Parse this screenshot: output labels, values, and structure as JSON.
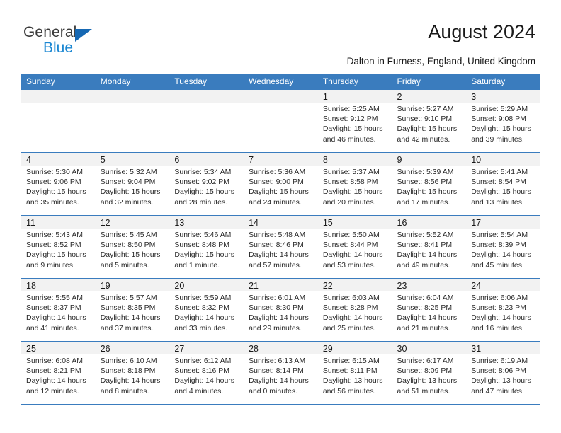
{
  "brand": {
    "name_top": "General",
    "name_bottom": "Blue",
    "accent_color": "#1b87d2",
    "triangle_color": "#1668b3"
  },
  "header": {
    "title": "August 2024",
    "subtitle": "Dalton in Furness, England, United Kingdom"
  },
  "theme": {
    "header_row_bg": "#3a7cbe",
    "cell_shade_bg": "#f2f2f2",
    "grid_line": "#3a7cbe"
  },
  "weekdays": [
    "Sunday",
    "Monday",
    "Tuesday",
    "Wednesday",
    "Thursday",
    "Friday",
    "Saturday"
  ],
  "labels": {
    "sunrise_prefix": "Sunrise:",
    "sunset_prefix": "Sunset:",
    "daylight_prefix": "Daylight:"
  },
  "weeks": [
    [
      {
        "empty": true
      },
      {
        "empty": true
      },
      {
        "empty": true
      },
      {
        "empty": true
      },
      {
        "day": "1",
        "sunrise": "Sunrise: 5:25 AM",
        "sunset": "Sunset: 9:12 PM",
        "daylight1": "Daylight: 15 hours",
        "daylight2": "and 46 minutes."
      },
      {
        "day": "2",
        "sunrise": "Sunrise: 5:27 AM",
        "sunset": "Sunset: 9:10 PM",
        "daylight1": "Daylight: 15 hours",
        "daylight2": "and 42 minutes."
      },
      {
        "day": "3",
        "sunrise": "Sunrise: 5:29 AM",
        "sunset": "Sunset: 9:08 PM",
        "daylight1": "Daylight: 15 hours",
        "daylight2": "and 39 minutes."
      }
    ],
    [
      {
        "day": "4",
        "sunrise": "Sunrise: 5:30 AM",
        "sunset": "Sunset: 9:06 PM",
        "daylight1": "Daylight: 15 hours",
        "daylight2": "and 35 minutes."
      },
      {
        "day": "5",
        "sunrise": "Sunrise: 5:32 AM",
        "sunset": "Sunset: 9:04 PM",
        "daylight1": "Daylight: 15 hours",
        "daylight2": "and 32 minutes."
      },
      {
        "day": "6",
        "sunrise": "Sunrise: 5:34 AM",
        "sunset": "Sunset: 9:02 PM",
        "daylight1": "Daylight: 15 hours",
        "daylight2": "and 28 minutes."
      },
      {
        "day": "7",
        "sunrise": "Sunrise: 5:36 AM",
        "sunset": "Sunset: 9:00 PM",
        "daylight1": "Daylight: 15 hours",
        "daylight2": "and 24 minutes."
      },
      {
        "day": "8",
        "sunrise": "Sunrise: 5:37 AM",
        "sunset": "Sunset: 8:58 PM",
        "daylight1": "Daylight: 15 hours",
        "daylight2": "and 20 minutes."
      },
      {
        "day": "9",
        "sunrise": "Sunrise: 5:39 AM",
        "sunset": "Sunset: 8:56 PM",
        "daylight1": "Daylight: 15 hours",
        "daylight2": "and 17 minutes."
      },
      {
        "day": "10",
        "sunrise": "Sunrise: 5:41 AM",
        "sunset": "Sunset: 8:54 PM",
        "daylight1": "Daylight: 15 hours",
        "daylight2": "and 13 minutes."
      }
    ],
    [
      {
        "day": "11",
        "sunrise": "Sunrise: 5:43 AM",
        "sunset": "Sunset: 8:52 PM",
        "daylight1": "Daylight: 15 hours",
        "daylight2": "and 9 minutes."
      },
      {
        "day": "12",
        "sunrise": "Sunrise: 5:45 AM",
        "sunset": "Sunset: 8:50 PM",
        "daylight1": "Daylight: 15 hours",
        "daylight2": "and 5 minutes."
      },
      {
        "day": "13",
        "sunrise": "Sunrise: 5:46 AM",
        "sunset": "Sunset: 8:48 PM",
        "daylight1": "Daylight: 15 hours",
        "daylight2": "and 1 minute."
      },
      {
        "day": "14",
        "sunrise": "Sunrise: 5:48 AM",
        "sunset": "Sunset: 8:46 PM",
        "daylight1": "Daylight: 14 hours",
        "daylight2": "and 57 minutes."
      },
      {
        "day": "15",
        "sunrise": "Sunrise: 5:50 AM",
        "sunset": "Sunset: 8:44 PM",
        "daylight1": "Daylight: 14 hours",
        "daylight2": "and 53 minutes."
      },
      {
        "day": "16",
        "sunrise": "Sunrise: 5:52 AM",
        "sunset": "Sunset: 8:41 PM",
        "daylight1": "Daylight: 14 hours",
        "daylight2": "and 49 minutes."
      },
      {
        "day": "17",
        "sunrise": "Sunrise: 5:54 AM",
        "sunset": "Sunset: 8:39 PM",
        "daylight1": "Daylight: 14 hours",
        "daylight2": "and 45 minutes."
      }
    ],
    [
      {
        "day": "18",
        "sunrise": "Sunrise: 5:55 AM",
        "sunset": "Sunset: 8:37 PM",
        "daylight1": "Daylight: 14 hours",
        "daylight2": "and 41 minutes."
      },
      {
        "day": "19",
        "sunrise": "Sunrise: 5:57 AM",
        "sunset": "Sunset: 8:35 PM",
        "daylight1": "Daylight: 14 hours",
        "daylight2": "and 37 minutes."
      },
      {
        "day": "20",
        "sunrise": "Sunrise: 5:59 AM",
        "sunset": "Sunset: 8:32 PM",
        "daylight1": "Daylight: 14 hours",
        "daylight2": "and 33 minutes."
      },
      {
        "day": "21",
        "sunrise": "Sunrise: 6:01 AM",
        "sunset": "Sunset: 8:30 PM",
        "daylight1": "Daylight: 14 hours",
        "daylight2": "and 29 minutes."
      },
      {
        "day": "22",
        "sunrise": "Sunrise: 6:03 AM",
        "sunset": "Sunset: 8:28 PM",
        "daylight1": "Daylight: 14 hours",
        "daylight2": "and 25 minutes."
      },
      {
        "day": "23",
        "sunrise": "Sunrise: 6:04 AM",
        "sunset": "Sunset: 8:25 PM",
        "daylight1": "Daylight: 14 hours",
        "daylight2": "and 21 minutes."
      },
      {
        "day": "24",
        "sunrise": "Sunrise: 6:06 AM",
        "sunset": "Sunset: 8:23 PM",
        "daylight1": "Daylight: 14 hours",
        "daylight2": "and 16 minutes."
      }
    ],
    [
      {
        "day": "25",
        "sunrise": "Sunrise: 6:08 AM",
        "sunset": "Sunset: 8:21 PM",
        "daylight1": "Daylight: 14 hours",
        "daylight2": "and 12 minutes."
      },
      {
        "day": "26",
        "sunrise": "Sunrise: 6:10 AM",
        "sunset": "Sunset: 8:18 PM",
        "daylight1": "Daylight: 14 hours",
        "daylight2": "and 8 minutes."
      },
      {
        "day": "27",
        "sunrise": "Sunrise: 6:12 AM",
        "sunset": "Sunset: 8:16 PM",
        "daylight1": "Daylight: 14 hours",
        "daylight2": "and 4 minutes."
      },
      {
        "day": "28",
        "sunrise": "Sunrise: 6:13 AM",
        "sunset": "Sunset: 8:14 PM",
        "daylight1": "Daylight: 14 hours",
        "daylight2": "and 0 minutes."
      },
      {
        "day": "29",
        "sunrise": "Sunrise: 6:15 AM",
        "sunset": "Sunset: 8:11 PM",
        "daylight1": "Daylight: 13 hours",
        "daylight2": "and 56 minutes."
      },
      {
        "day": "30",
        "sunrise": "Sunrise: 6:17 AM",
        "sunset": "Sunset: 8:09 PM",
        "daylight1": "Daylight: 13 hours",
        "daylight2": "and 51 minutes."
      },
      {
        "day": "31",
        "sunrise": "Sunrise: 6:19 AM",
        "sunset": "Sunset: 8:06 PM",
        "daylight1": "Daylight: 13 hours",
        "daylight2": "and 47 minutes."
      }
    ]
  ]
}
